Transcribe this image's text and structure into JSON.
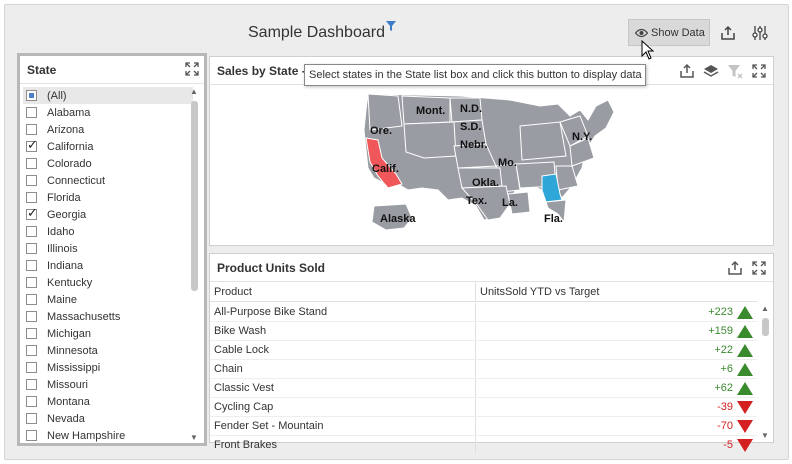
{
  "header": {
    "title": "Sample Dashboard",
    "show_data_label": "Show Data"
  },
  "state_panel": {
    "title": "State",
    "items": [
      {
        "label": "(All)",
        "state": "indeterminate"
      },
      {
        "label": "Alabama",
        "state": "unchecked"
      },
      {
        "label": "Arizona",
        "state": "unchecked"
      },
      {
        "label": "California",
        "state": "checked"
      },
      {
        "label": "Colorado",
        "state": "unchecked"
      },
      {
        "label": "Connecticut",
        "state": "unchecked"
      },
      {
        "label": "Florida",
        "state": "unchecked"
      },
      {
        "label": "Georgia",
        "state": "checked"
      },
      {
        "label": "Idaho",
        "state": "unchecked"
      },
      {
        "label": "Illinois",
        "state": "unchecked"
      },
      {
        "label": "Indiana",
        "state": "unchecked"
      },
      {
        "label": "Kentucky",
        "state": "unchecked"
      },
      {
        "label": "Maine",
        "state": "unchecked"
      },
      {
        "label": "Massachusetts",
        "state": "unchecked"
      },
      {
        "label": "Michigan",
        "state": "unchecked"
      },
      {
        "label": "Minnesota",
        "state": "unchecked"
      },
      {
        "label": "Mississippi",
        "state": "unchecked"
      },
      {
        "label": "Missouri",
        "state": "unchecked"
      },
      {
        "label": "Montana",
        "state": "unchecked"
      },
      {
        "label": "Nevada",
        "state": "unchecked"
      },
      {
        "label": "New Hampshire",
        "state": "unchecked"
      }
    ]
  },
  "map_panel": {
    "title": "Sales by State -",
    "tooltip": "Select states in the State list box and click this button to display data",
    "labels": [
      "Mont.",
      "N.D.",
      "S.D.",
      "Ore.",
      "Nebr.",
      "N.Y.",
      "Calif.",
      "Mo.",
      "Okla.",
      "Tex.",
      "La.",
      "Alaska",
      "Fla."
    ],
    "highlight_color_ca": "#f0575a",
    "highlight_color_ga": "#2ea6d8",
    "state_color": "#9a9ca3"
  },
  "grid_panel": {
    "title": "Product Units Sold",
    "columns": [
      "Product",
      "UnitsSold YTD vs Target"
    ],
    "rows": [
      {
        "product": "All-Purpose Bike Stand",
        "value": "+223",
        "trend": "up"
      },
      {
        "product": "Bike Wash",
        "value": "+159",
        "trend": "up"
      },
      {
        "product": "Cable Lock",
        "value": "+22",
        "trend": "up"
      },
      {
        "product": "Chain",
        "value": "+6",
        "trend": "up"
      },
      {
        "product": "Classic Vest",
        "value": "+62",
        "trend": "up"
      },
      {
        "product": "Cycling Cap",
        "value": "-39",
        "trend": "down"
      },
      {
        "product": "Fender Set - Mountain",
        "value": "-70",
        "trend": "down"
      },
      {
        "product": "Front Brakes",
        "value": "-5",
        "trend": "down"
      }
    ],
    "colors": {
      "positive": "#3a8a2e",
      "negative": "#d42020"
    }
  }
}
